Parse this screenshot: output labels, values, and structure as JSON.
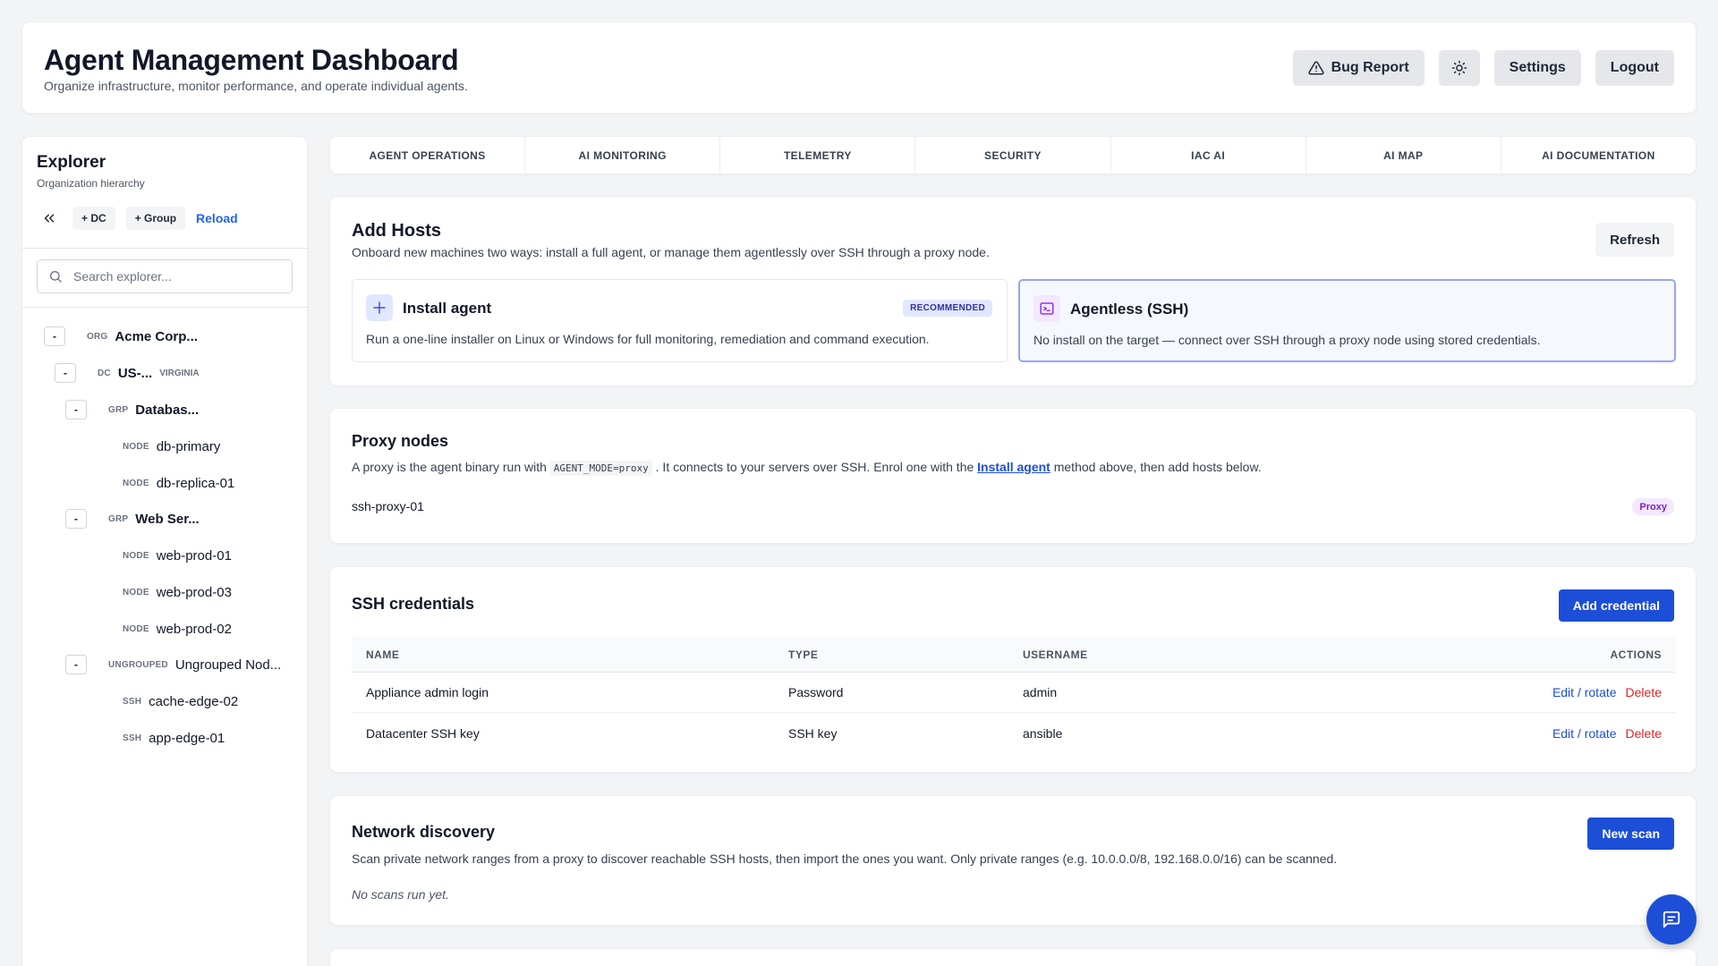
{
  "header": {
    "title": "Agent Management Dashboard",
    "subtitle": "Organize infrastructure, monitor performance, and operate individual agents.",
    "bug_report": "Bug Report",
    "settings": "Settings",
    "logout": "Logout"
  },
  "sidebar": {
    "title": "Explorer",
    "subtitle": "Organization hierarchy",
    "add_dc": "+ DC",
    "add_group": "+ Group",
    "reload": "Reload",
    "search_placeholder": "Search explorer...",
    "tree": [
      {
        "toggle": "-",
        "tag": "ORG",
        "name": "Acme Corp..."
      },
      {
        "toggle": "-",
        "tag": "DC",
        "name": "US-...",
        "location": "VIRGINIA"
      },
      {
        "toggle": "-",
        "tag": "GRP",
        "name": "Databas..."
      },
      {
        "tag": "NODE",
        "name": "db-primary"
      },
      {
        "tag": "NODE",
        "name": "db-replica-01"
      },
      {
        "toggle": "-",
        "tag": "GRP",
        "name": "Web Ser..."
      },
      {
        "tag": "NODE",
        "name": "web-prod-01"
      },
      {
        "tag": "NODE",
        "name": "web-prod-03"
      },
      {
        "tag": "NODE",
        "name": "web-prod-02"
      },
      {
        "toggle": "-",
        "tag": "UNGROUPED",
        "name": "Ungrouped Nod..."
      },
      {
        "tag": "SSH",
        "name": "cache-edge-02"
      },
      {
        "tag": "SSH",
        "name": "app-edge-01"
      }
    ]
  },
  "tabs": [
    {
      "label": "AGENT OPERATIONS"
    },
    {
      "label": "AI MONITORING"
    },
    {
      "label": "TELEMETRY"
    },
    {
      "label": "SECURITY"
    },
    {
      "label": "IAC AI"
    },
    {
      "label": "AI MAP"
    },
    {
      "label": "AI DOCUMENTATION"
    }
  ],
  "add_hosts": {
    "title": "Add Hosts",
    "description": "Onboard new machines two ways: install a full agent, or manage them agentlessly over SSH through a proxy node.",
    "refresh": "Refresh",
    "install": {
      "title": "Install agent",
      "badge": "RECOMMENDED",
      "description": "Run a one-line installer on Linux or Windows for full monitoring, remediation and command execution."
    },
    "agentless": {
      "title": "Agentless (SSH)",
      "description": "No install on the target — connect over SSH through a proxy node using stored credentials."
    }
  },
  "proxy": {
    "title": "Proxy nodes",
    "desc_a": "A proxy is the agent binary run with",
    "desc_code": "AGENT_MODE=proxy",
    "desc_b": ". It connects to your servers over SSH. Enrol one with the",
    "desc_link": "Install agent",
    "desc_c": "method above, then add hosts below.",
    "node_name": "ssh-proxy-01",
    "node_badge": "Proxy"
  },
  "ssh": {
    "title": "SSH credentials",
    "add": "Add credential",
    "columns": [
      "NAME",
      "TYPE",
      "USERNAME",
      "ACTIONS"
    ],
    "rows": [
      {
        "name": "Appliance admin login",
        "type": "Password",
        "username": "admin",
        "edit": "Edit / rotate",
        "delete": "Delete"
      },
      {
        "name": "Datacenter SSH key",
        "type": "SSH key",
        "username": "ansible",
        "edit": "Edit / rotate",
        "delete": "Delete"
      }
    ]
  },
  "discovery": {
    "title": "Network discovery",
    "new_scan": "New scan",
    "description": "Scan private network ranges from a proxy to discover reachable SSH hosts, then import the ones you want. Only private ranges (e.g. 10.0.0.0/8, 192.168.0.0/16) can be scanned.",
    "empty": "No scans run yet."
  },
  "icons": {
    "bug": "warning-triangle-icon",
    "theme": "sun-icon",
    "collapse": "double-chevron-left-icon",
    "search": "search-icon",
    "install": "plus-icon",
    "agentless": "terminal-icon",
    "chat": "chat-icon"
  },
  "colors": {
    "accent": "#1d4ed8",
    "danger": "#dc2626",
    "proxy_badge": "#7e22ce"
  }
}
